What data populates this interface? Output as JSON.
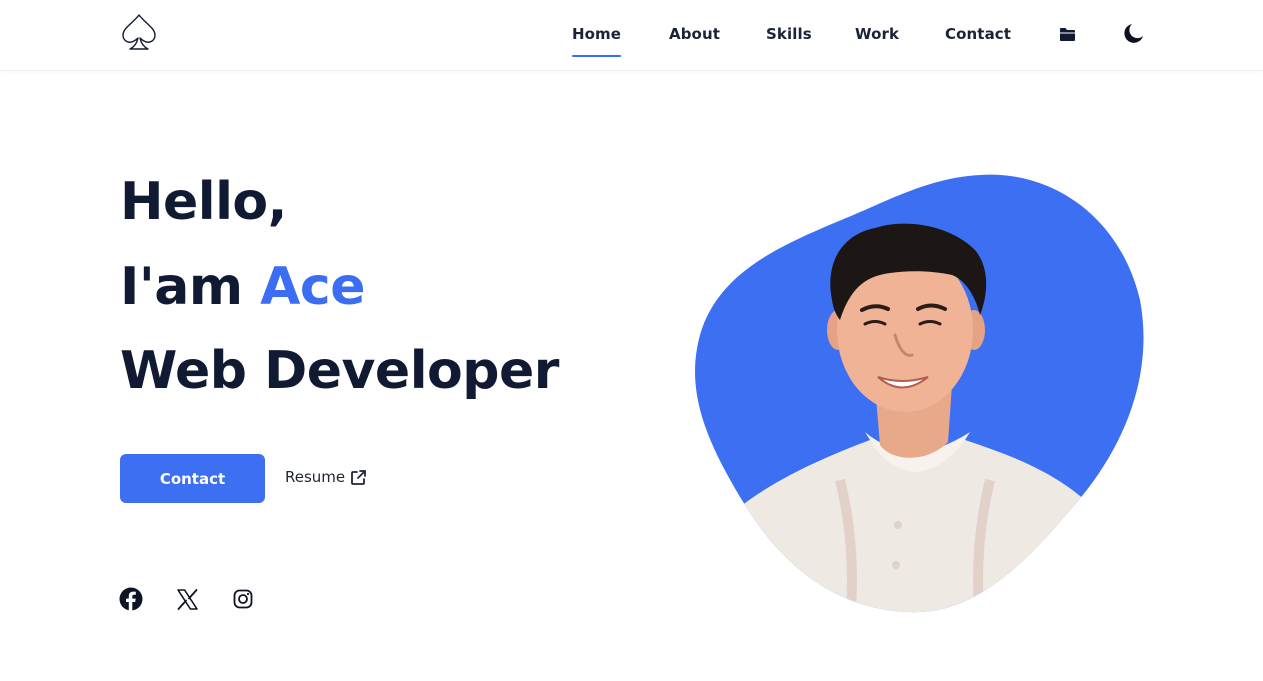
{
  "header": {
    "logo_icon": "spade-icon",
    "nav": [
      {
        "label": "Home",
        "active": true
      },
      {
        "label": "About",
        "active": false
      },
      {
        "label": "Skills",
        "active": false
      },
      {
        "label": "Work",
        "active": false
      },
      {
        "label": "Contact",
        "active": false
      }
    ],
    "folder_icon": "folder-icon",
    "theme_icon": "moon-icon"
  },
  "hero": {
    "greeting": "Hello,",
    "intro_prefix": "I'am ",
    "name": "Ace",
    "role": "Web Developer",
    "contact_button": "Contact",
    "resume_link": "Resume",
    "resume_icon": "external-link-icon"
  },
  "social": [
    {
      "icon": "facebook-icon"
    },
    {
      "icon": "x-twitter-icon"
    },
    {
      "icon": "instagram-icon"
    }
  ],
  "portrait": {
    "blob_color": "#3d6ff3",
    "image_alt": "portrait photo"
  },
  "colors": {
    "accent": "#3b6ef2",
    "text": "#111a33",
    "background": "#ffffff"
  }
}
